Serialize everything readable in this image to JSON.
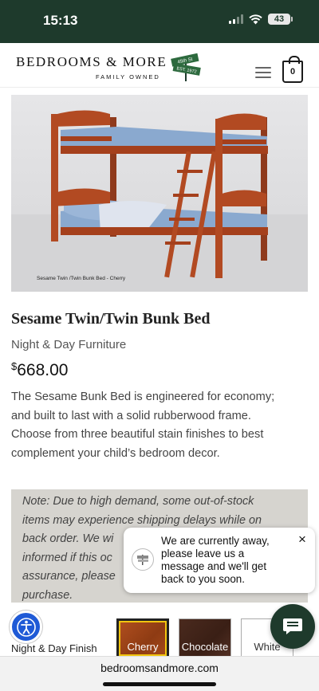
{
  "status_bar": {
    "time": "15:13",
    "battery": "43"
  },
  "header": {
    "logo_main": "BEDROOMS & MORE",
    "logo_sub": "FAMILY OWNED",
    "logo_sign_top": "45th St",
    "logo_sign_bottom": "EST. 1972",
    "cart_count": "0"
  },
  "product": {
    "image_caption": "Sesame Twin /Twin Bunk Bed - Cherry",
    "title": "Sesame Twin/Twin Bunk Bed",
    "brand": "Night & Day Furniture",
    "price_symbol": "$",
    "price_value": "668.00",
    "description_lines": [
      "The Sesame Bunk Bed is engineered for economy;",
      "and built to last with a solid rubberwood frame.",
      "Choose from three beautiful stain finishes to best",
      "complement your child’s bedroom decor."
    ]
  },
  "note": {
    "lines": [
      "Note: Due to high demand, some out-of-stock",
      "items may experience shipping delays while on",
      "back order. We wi",
      "informed if this oc",
      "assurance, please",
      "purchase."
    ]
  },
  "chat_popup": {
    "message": "We are currently away, please leave us a message and we'll get back to you soon.",
    "close": "×"
  },
  "finish": {
    "label": "Night & Day Finish",
    "options": [
      "Cherry",
      "Chocolate",
      "White"
    ],
    "selected": "Cherry"
  },
  "browser": {
    "url": "bedroomsandmore.com"
  },
  "icons": {
    "menu": "hamburger-menu-icon",
    "cart": "shopping-bag-icon",
    "accessibility": "accessibility-icon",
    "chat": "chat-bubble-icon",
    "close": "close-icon"
  },
  "colors": {
    "brand_dark_green": "#1e3a2c",
    "accessibility_blue": "#1f5ad6",
    "note_background": "#d6d4cf",
    "selected_outline": "#f1c40f"
  }
}
